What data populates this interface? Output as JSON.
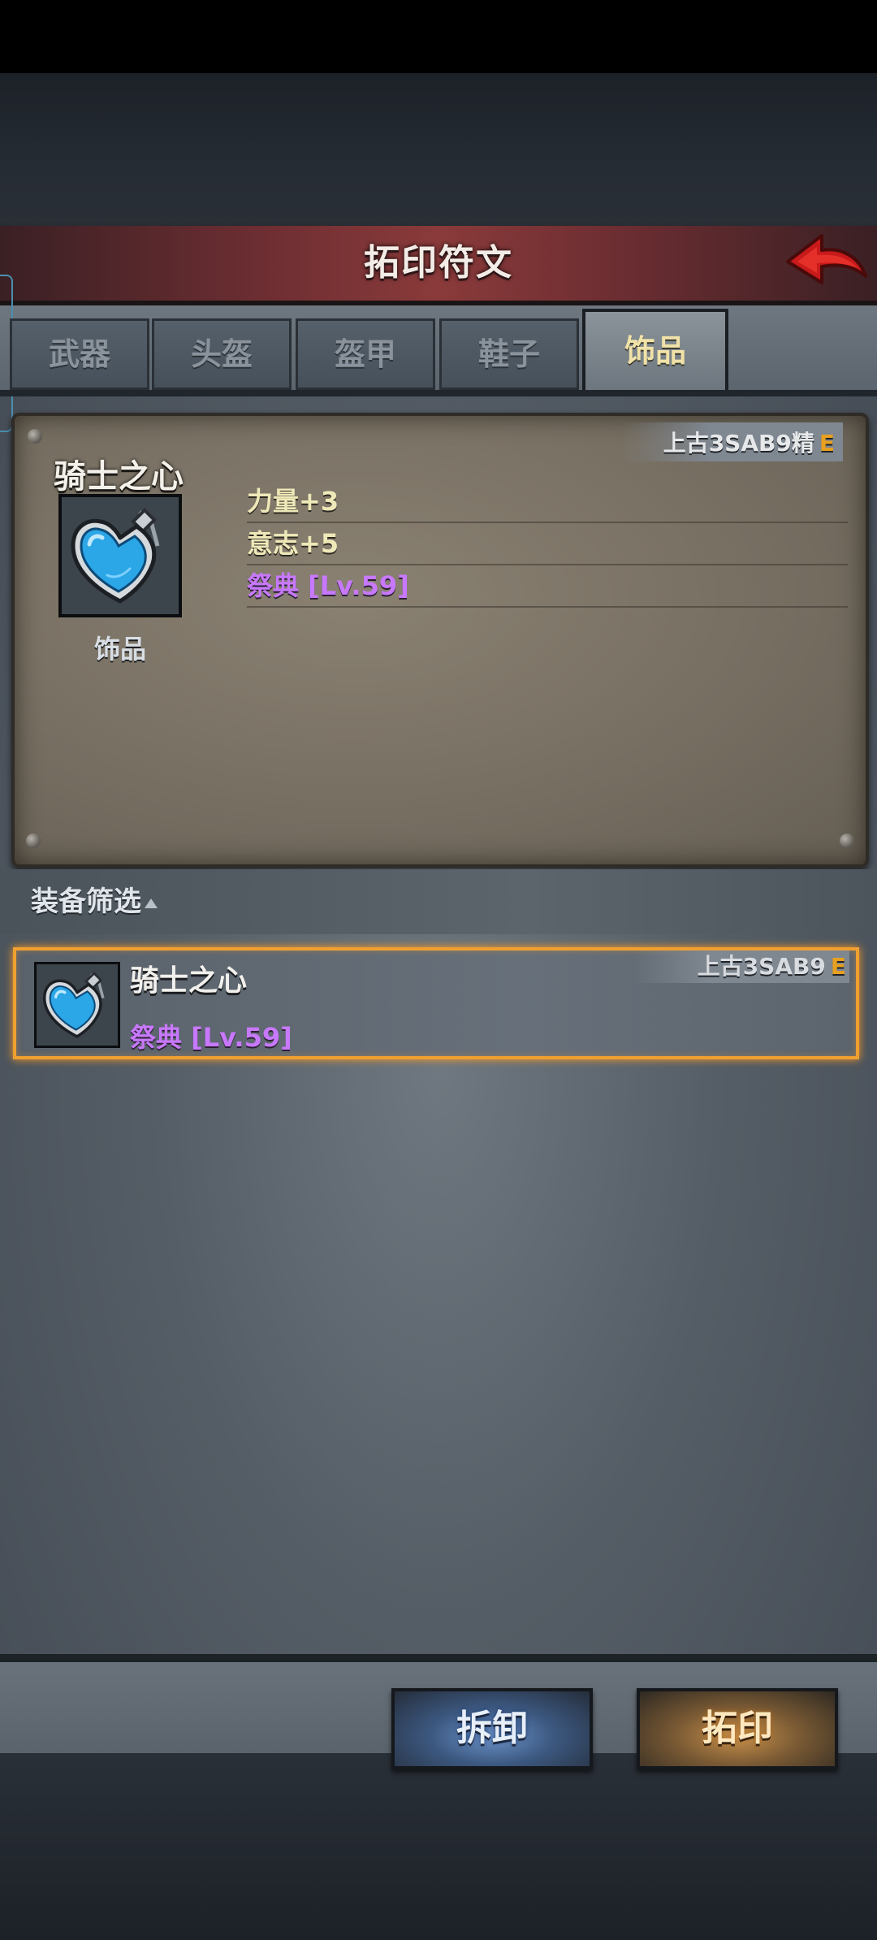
{
  "header": {
    "title": "拓印符文"
  },
  "tabs": [
    {
      "label": "武器",
      "active": false
    },
    {
      "label": "头盔",
      "active": false
    },
    {
      "label": "盔甲",
      "active": false
    },
    {
      "label": "鞋子",
      "active": false
    },
    {
      "label": "饰品",
      "active": true
    }
  ],
  "detail": {
    "grade": "上古3SAB9精",
    "grade_letter": "E",
    "name": "骑士之心",
    "type": "饰品",
    "icon": "heart-pendant-icon",
    "stats": [
      "力量+3",
      "意志+5"
    ],
    "set": "祭典 [Lv.59]"
  },
  "filter": {
    "label": "装备筛选"
  },
  "list": [
    {
      "name": "骑士之心",
      "set": "祭典 [Lv.59]",
      "grade": "上古3SAB9",
      "grade_letter": "E",
      "icon": "heart-pendant-icon",
      "selected": true
    }
  ],
  "actions": {
    "disassemble": "拆卸",
    "imprint": "拓印"
  },
  "colors": {
    "header_red": "#8a3a3a",
    "active_tab_text": "#f0e2a8",
    "purple_set": "#c878ff",
    "selection_orange": "#f0a030",
    "grade_e": "#e8a020"
  }
}
